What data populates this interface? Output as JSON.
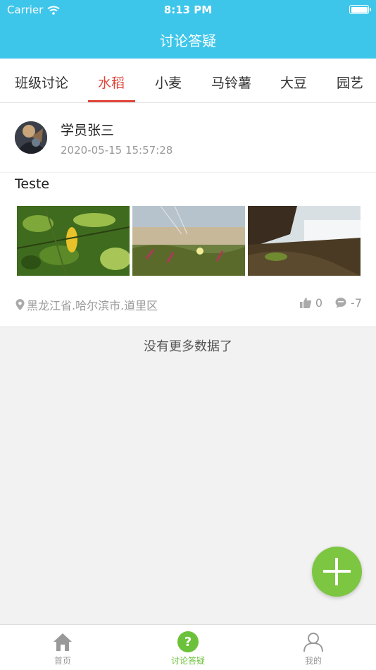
{
  "status_bar": {
    "carrier": "Carrier",
    "time": "8:13 PM"
  },
  "nav": {
    "title": "讨论答疑"
  },
  "tabs": [
    {
      "label": "班级讨论"
    },
    {
      "label": "水稻",
      "active": true
    },
    {
      "label": "小麦"
    },
    {
      "label": "马铃薯"
    },
    {
      "label": "大豆"
    },
    {
      "label": "园艺"
    }
  ],
  "post": {
    "author": "学员张三",
    "timestamp": "2020-05-15 15:57:28",
    "content": "Teste",
    "location": "黑龙江省.哈尔滨市.道里区",
    "likes": "0",
    "comments": "-7"
  },
  "footer_message": "没有更多数据了",
  "tabbar": [
    {
      "label": "首页",
      "icon": "home-icon"
    },
    {
      "label": "讨论答疑",
      "icon": "question-icon",
      "active": true
    },
    {
      "label": "我的",
      "icon": "person-icon"
    }
  ],
  "colors": {
    "brand": "#3ec6ea",
    "accent": "#e0463c",
    "fab": "#7dc641",
    "tab_active": "#6cc13a"
  }
}
